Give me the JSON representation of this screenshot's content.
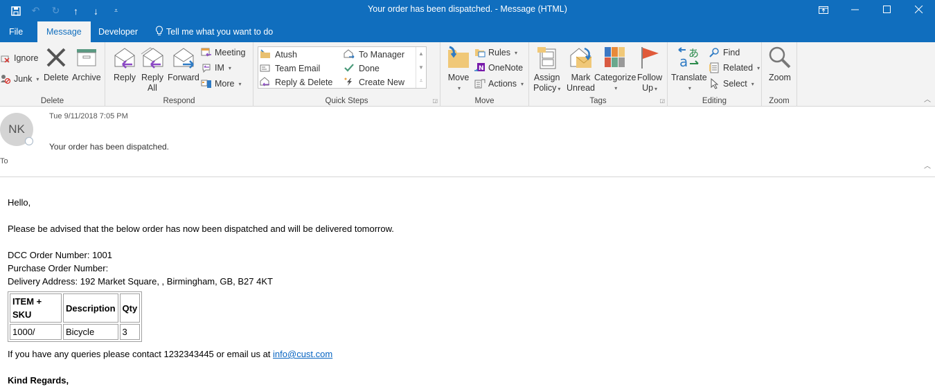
{
  "window": {
    "title": "Your order  has been dispatched.  -  Message (HTML)",
    "qat": [
      "save-icon",
      "undo-icon",
      "redo-icon",
      "previous-item-icon",
      "next-item-icon",
      "customize-qat-icon"
    ],
    "controls": [
      "ribbon-display-options",
      "minimize",
      "maximize",
      "close"
    ]
  },
  "tabs": [
    {
      "label": "File"
    },
    {
      "label": "Message",
      "active": true
    },
    {
      "label": "Developer"
    },
    {
      "label": "Tell me what you want to do"
    }
  ],
  "ribbon": {
    "delete": {
      "label": "Delete",
      "ignore": "Ignore",
      "junk": "Junk",
      "delete": "Delete",
      "archive": "Archive"
    },
    "respond": {
      "label": "Respond",
      "reply": "Reply",
      "reply_all_1": "Reply",
      "reply_all_2": "All",
      "forward": "Forward",
      "meeting": "Meeting",
      "im": "IM",
      "more": "More"
    },
    "quick_steps": {
      "label": "Quick Steps",
      "items": [
        "Atush",
        "To Manager",
        "Team Email",
        "Done",
        "Reply & Delete",
        "Create New"
      ]
    },
    "move": {
      "label": "Move",
      "move": "Move",
      "rules": "Rules",
      "onenote": "OneNote",
      "actions": "Actions"
    },
    "tags": {
      "label": "Tags",
      "assign_1": "Assign",
      "assign_2": "Policy",
      "mark_1": "Mark",
      "mark_2": "Unread",
      "categorize": "Categorize",
      "follow_1": "Follow",
      "follow_2": "Up"
    },
    "editing": {
      "label": "Editing",
      "translate": "Translate",
      "find": "Find",
      "related": "Related",
      "select": "Select"
    },
    "zoom": {
      "label": "Zoom",
      "zoom": "Zoom"
    }
  },
  "header": {
    "avatar_initials": "NK",
    "date": "Tue 9/11/2018 7:05 PM",
    "subject": "Your order  has been dispatched.",
    "to_label": "To"
  },
  "body": {
    "greeting": "Hello,",
    "intro": "Please be advised that the below order has now been dispatched and will be delivered tomorrow.",
    "order_number": "DCC Order Number: 1001",
    "po_number": "Purchase Order Number:",
    "address": "Delivery Address: 192 Market Square, , Birmingham, GB, B27 4KT",
    "table": {
      "headers": [
        "ITEM + SKU",
        "Description",
        "Qty"
      ],
      "rows": [
        [
          "1000/",
          "Bicycle",
          "3"
        ]
      ]
    },
    "contact_text": "If you have any queries please contact 1232343445 or email us at ",
    "email": "info@cust.com",
    "signoff": "Kind Regards,"
  }
}
